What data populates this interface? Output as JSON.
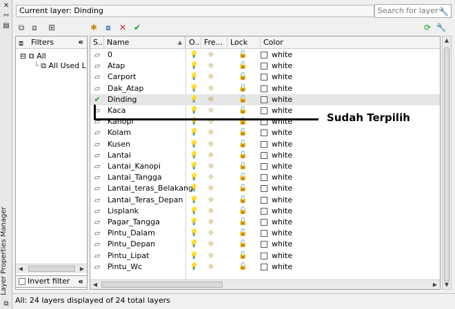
{
  "side": {
    "title": "Layer Properties Manager",
    "buttons": [
      {
        "icon": "close-icon",
        "glyph": "✕"
      },
      {
        "icon": "auto-hide-icon",
        "glyph": "⇿"
      },
      {
        "icon": "properties-icon",
        "glyph": "▤"
      }
    ]
  },
  "header": {
    "current_layer": "Current layer: Dinding",
    "search_placeholder": "Search for layer"
  },
  "toolbar": {
    "left_icons": [
      "new-property-filter-icon",
      "new-group-filter-icon",
      "layer-states-icon"
    ],
    "layer_icons": [
      "new-layer-icon",
      "new-layer-vp-frozen-icon",
      "delete-layer-icon",
      "set-current-icon"
    ],
    "right_icons": [
      "refresh-icon",
      "settings-icon"
    ]
  },
  "filters": {
    "title": "Filters",
    "tree": [
      {
        "label": "All"
      },
      {
        "label": "All Used L"
      }
    ],
    "invert_label": "Invert filter"
  },
  "grid": {
    "columns": {
      "status": "S..",
      "name": "Name",
      "on": "O..",
      "freeze": "Fre...",
      "lock": "Lock",
      "color": "Color"
    },
    "rows": [
      {
        "name": "0",
        "color": "white",
        "current": false
      },
      {
        "name": "Atap",
        "color": "white",
        "current": false
      },
      {
        "name": "Carport",
        "color": "white",
        "current": false
      },
      {
        "name": "Dak_Atap",
        "color": "white",
        "current": false
      },
      {
        "name": "Dinding",
        "color": "white",
        "current": true
      },
      {
        "name": "Kaca",
        "color": "white",
        "current": false
      },
      {
        "name": "Kanopi",
        "color": "white",
        "current": false
      },
      {
        "name": "Kolam",
        "color": "white",
        "current": false
      },
      {
        "name": "Kusen",
        "color": "white",
        "current": false
      },
      {
        "name": "Lantai",
        "color": "white",
        "current": false
      },
      {
        "name": "Lantai_Kanopi",
        "color": "white",
        "current": false
      },
      {
        "name": "Lantai_Tangga",
        "color": "white",
        "current": false
      },
      {
        "name": "Lantai_teras_Belakang",
        "color": "white",
        "current": false
      },
      {
        "name": "Lantai_Teras_Depan",
        "color": "white",
        "current": false
      },
      {
        "name": "Lisplank",
        "color": "white",
        "current": false
      },
      {
        "name": "Pagar_Tangga",
        "color": "white",
        "current": false
      },
      {
        "name": "Pintu_Dalam",
        "color": "white",
        "current": false
      },
      {
        "name": "Pintu_Depan",
        "color": "white",
        "current": false
      },
      {
        "name": "Pintu_Lipat",
        "color": "white",
        "current": false
      },
      {
        "name": "Pintu_Wc",
        "color": "white",
        "current": false
      }
    ]
  },
  "status": "All: 24 layers displayed of 24 total layers",
  "annotation": "Sudah Terpilih"
}
